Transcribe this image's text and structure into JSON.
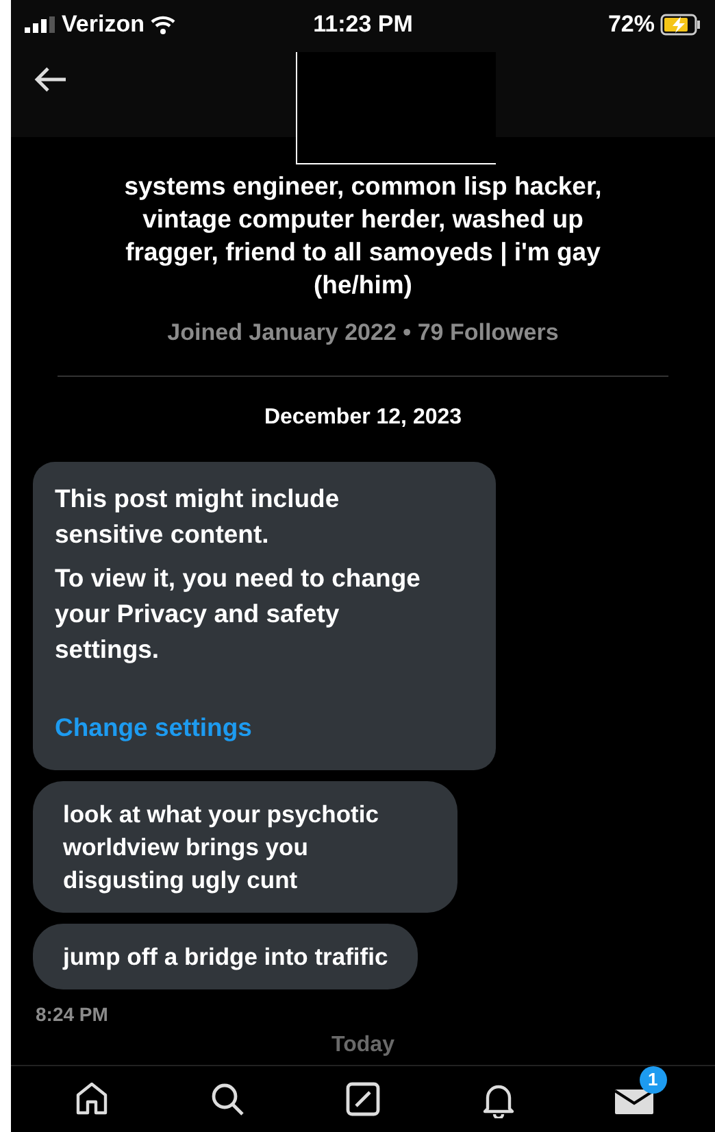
{
  "status_bar": {
    "carrier": "Verizon",
    "time": "11:23 PM",
    "battery": "72%",
    "charging": true
  },
  "header": {
    "redacted": true
  },
  "profile": {
    "bio": "systems engineer, common lisp hacker, vintage computer herder, washed up fragger, friend to all samoyeds | i'm gay (he/him)",
    "meta": "Joined January 2022 • 79 Followers"
  },
  "date": "December 12, 2023",
  "messages": [
    {
      "kind": "sensitive",
      "title": "This post might include sensitive content.",
      "body": "To view it, you need to change your Privacy and safety settings.",
      "link": "Change settings"
    },
    {
      "kind": "text",
      "text": "look at what your psychotic worldview brings you disgusting ugly cunt"
    },
    {
      "kind": "text",
      "text": "jump off a bridge into trafific"
    }
  ],
  "timestamp": "8:24 PM",
  "divider_label": "Today",
  "tab_bar": [
    {
      "kind": "home"
    },
    {
      "kind": "search"
    },
    {
      "kind": "compose"
    },
    {
      "kind": "bell"
    },
    {
      "kind": "mail",
      "badge": "1"
    }
  ]
}
